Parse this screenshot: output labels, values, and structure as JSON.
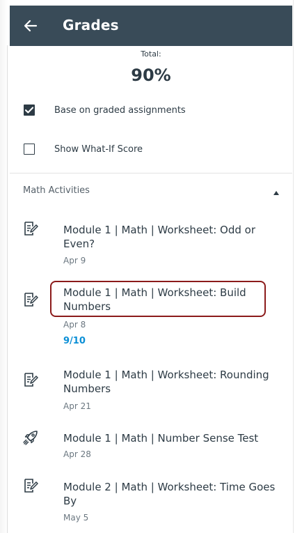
{
  "header": {
    "title": "Grades",
    "back_icon": "arrow-left-icon",
    "background": "#394b58"
  },
  "total": {
    "label": "Total:",
    "value": "90%"
  },
  "options": [
    {
      "label": "Base on graded assignments",
      "checked": true
    },
    {
      "label": "Show What-If Score",
      "checked": false
    }
  ],
  "section": {
    "label": "Math Activities",
    "collapse_icon": "triangle-up-icon"
  },
  "assignments": [
    {
      "title_line1": "Module 1 | Math | Worksheet: Odd or",
      "title_line2": "Even?",
      "date": "Apr 9",
      "score": "",
      "icon": "assignment-icon"
    },
    {
      "title_line1": "Module 1 | Math | Worksheet: Build",
      "title_line2": "Numbers",
      "date": "Apr 8",
      "score": "9/10",
      "icon": "assignment-icon",
      "highlighted": true
    },
    {
      "title_line1": "Module 1 | Math | Worksheet: Rounding",
      "title_line2": "Numbers",
      "date": "Apr 21",
      "score": "",
      "icon": "assignment-icon"
    },
    {
      "title_line1": "Module 1 | Math | Number Sense Test",
      "title_line2": "",
      "date": "Apr 28",
      "score": "",
      "icon": "quiz-rocket-icon"
    },
    {
      "title_line1": "Module 2 | Math | Worksheet: Time Goes",
      "title_line2": "By",
      "date": "May 5",
      "score": "",
      "icon": "assignment-icon"
    }
  ],
  "colors": {
    "score": "#0b8fd6",
    "highlight_border": "#8b1a1a",
    "text": "#2d3b45"
  }
}
